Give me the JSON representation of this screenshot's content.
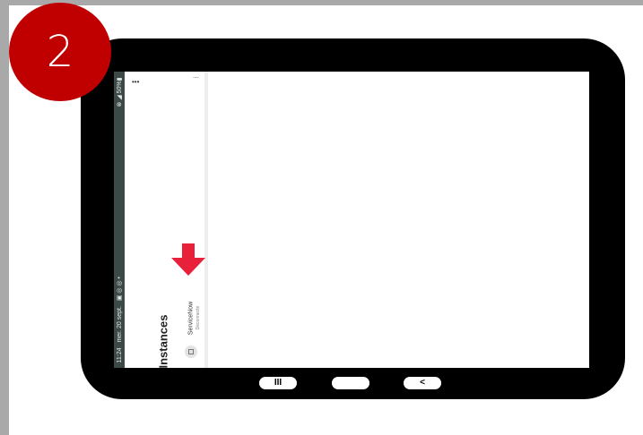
{
  "step": {
    "number": "2"
  },
  "status_bar": {
    "time": "11:24",
    "date": "mer. 20 sept.",
    "left_icons": "▣ ◎ ◎ •",
    "right_status": "⊗ ◢ 50%▮"
  },
  "panel": {
    "title": "Instances",
    "more_label": "•••",
    "dots_label": "⋯",
    "item": {
      "name": "ServiceNow",
      "status": "Déconnecté"
    }
  },
  "nav": {
    "recent_label": "III",
    "home_label": "",
    "back_label": "<"
  },
  "icons": {
    "pointer": "arrow-down-icon",
    "instance": "server-icon"
  },
  "colors": {
    "badge": "#c00000",
    "arrow": "#e8203a",
    "tablet_frame": "#000000",
    "statusbar": "#3b4a46"
  }
}
